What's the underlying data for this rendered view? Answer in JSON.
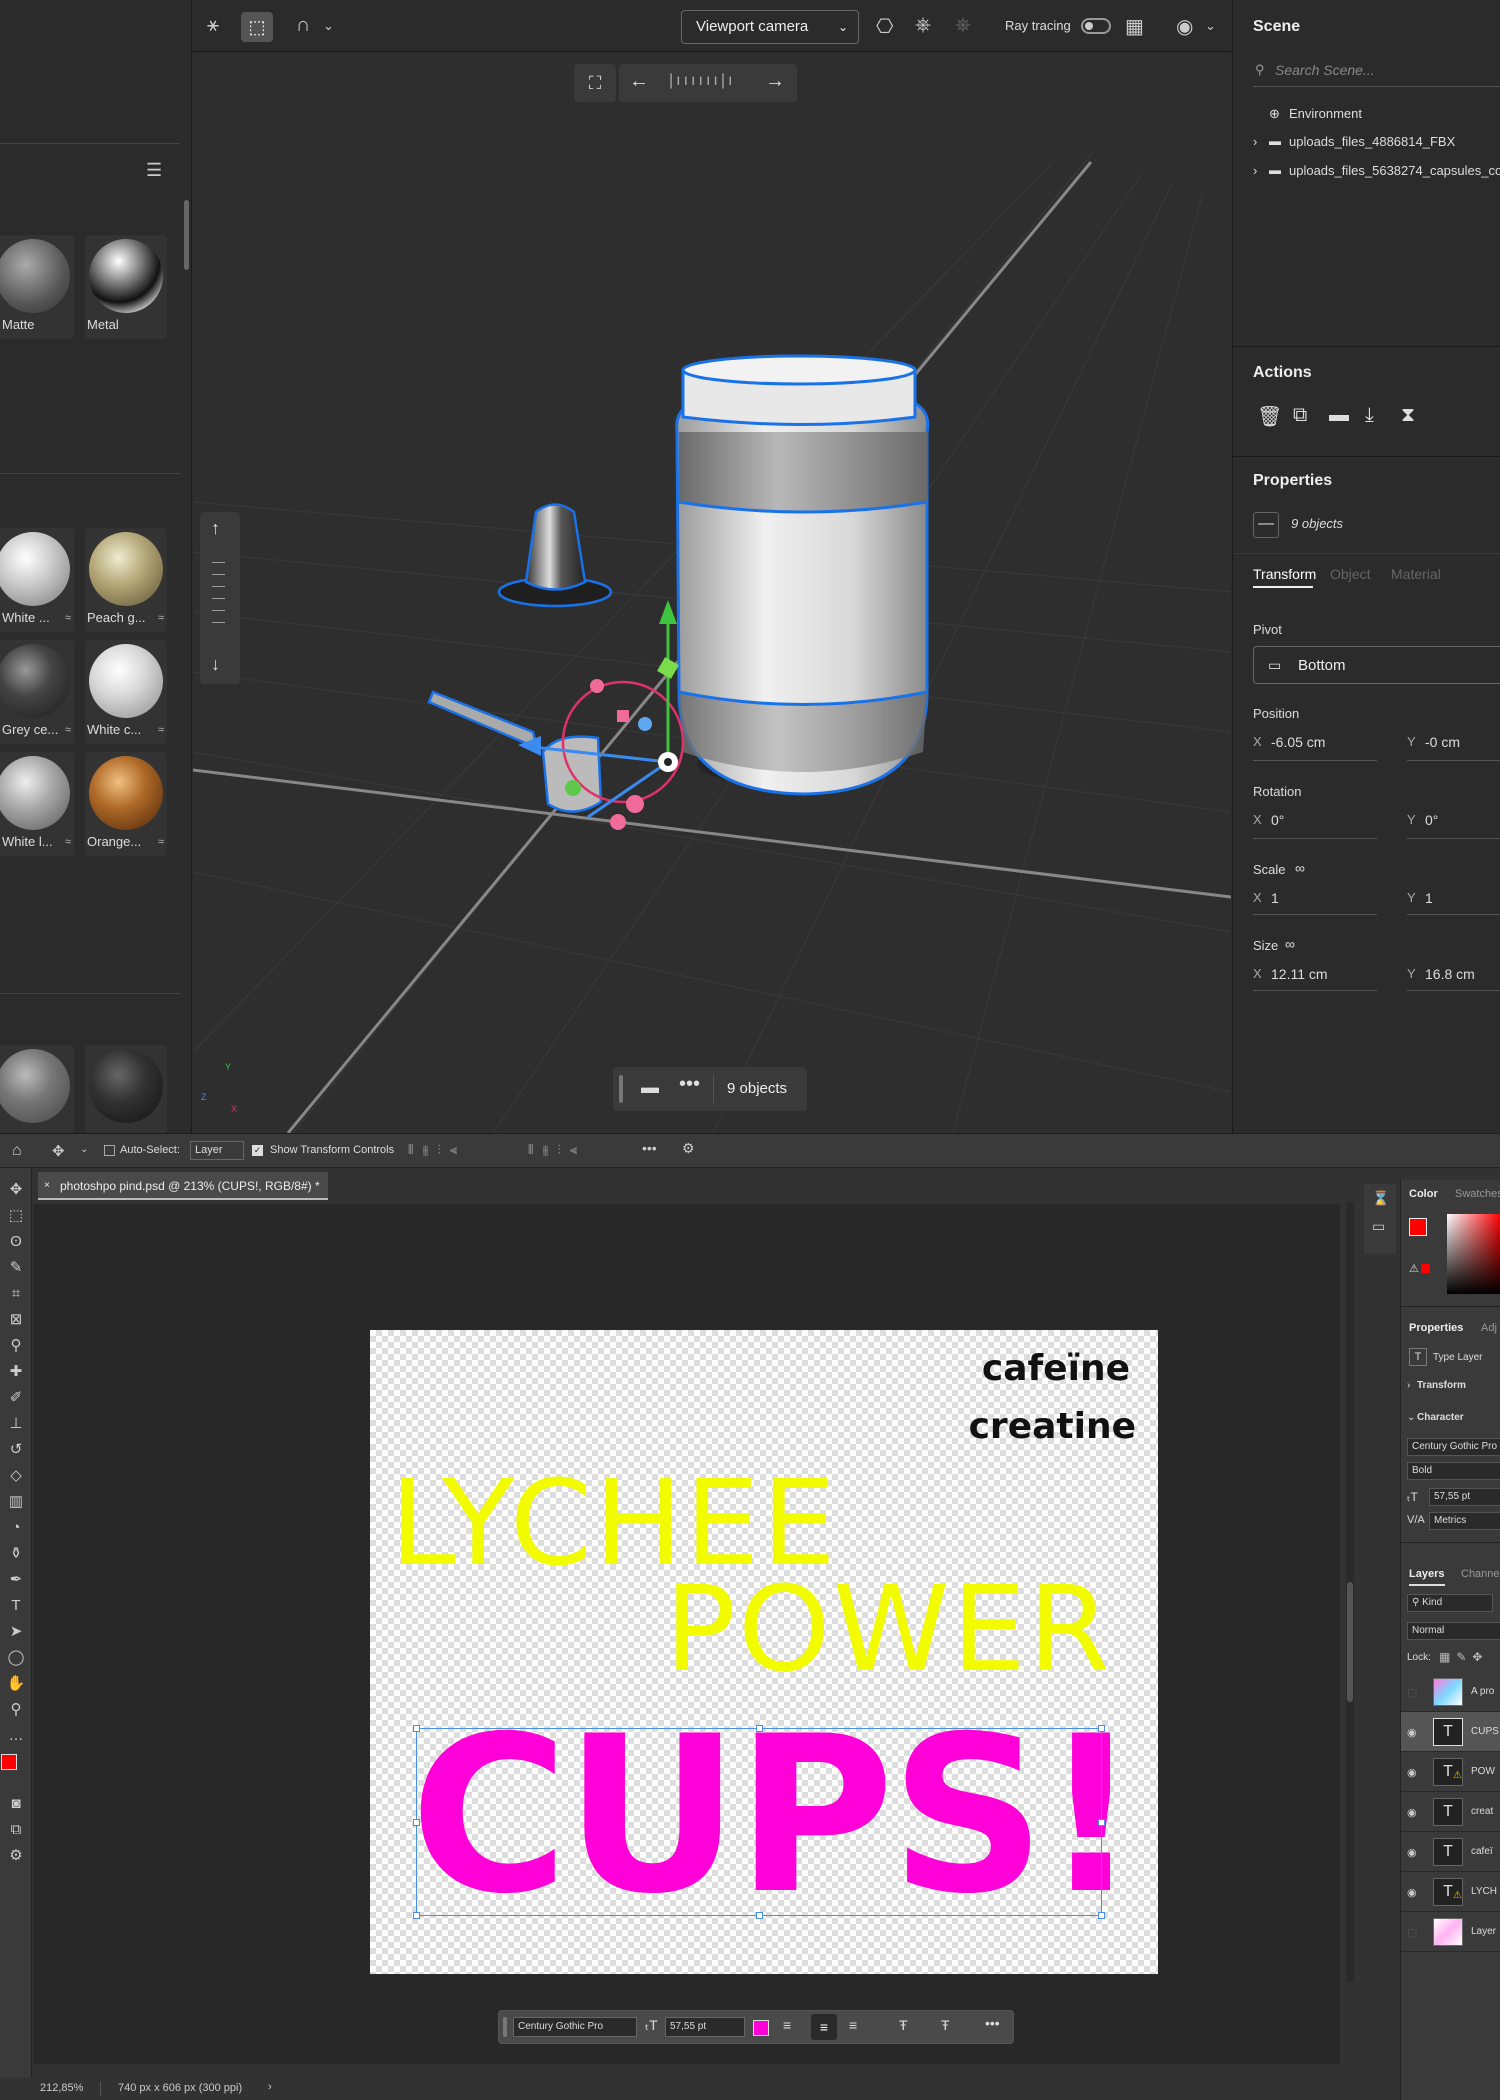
{
  "stager": {
    "toolbar": {
      "camera_select": "Viewport camera",
      "ray_tracing_label": "Ray tracing"
    },
    "materials": [
      {
        "label": "Matte",
        "color": "#8a8a8a"
      },
      {
        "label": "Metal",
        "color": "#d0d0d0"
      },
      {
        "label": "White ...",
        "color": "#e8e8e8"
      },
      {
        "label": "Peach g...",
        "color": "#b6a97a"
      },
      {
        "label": "Grey ce...",
        "color": "#5a5a5a"
      },
      {
        "label": "White c...",
        "color": "#e0e0e0"
      },
      {
        "label": "White l...",
        "color": "#bdbdbd"
      },
      {
        "label": "Orange...",
        "color": "#b06a28"
      }
    ],
    "scene": {
      "title": "Scene",
      "search_placeholder": "Search Scene...",
      "items": [
        "Environment",
        "uploads_files_4886814_FBX",
        "uploads_files_5638274_capsules_co"
      ]
    },
    "actions": {
      "title": "Actions"
    },
    "properties": {
      "title": "Properties",
      "selection": "9 objects",
      "tabs": [
        "Transform",
        "Object",
        "Material"
      ],
      "pivot_label": "Pivot",
      "pivot_value": "Bottom",
      "position_label": "Position",
      "position_x": "-6.05 cm",
      "position_y": "-0 cm",
      "rotation_label": "Rotation",
      "rotation_x": "0°",
      "rotation_y": "0°",
      "scale_label": "Scale",
      "scale_x": "1",
      "scale_y": "1",
      "size_label": "Size",
      "size_x": "12.11 cm",
      "size_y": "16.8 cm",
      "axis_x": "X",
      "axis_y": "Y"
    },
    "viewport_footer": {
      "objects": "9 objects"
    },
    "gizmo_axes": {
      "x": "X",
      "y": "Y",
      "z": "Z"
    }
  },
  "photoshop": {
    "options": {
      "auto_select": "Auto-Select:",
      "auto_select_value": "Layer",
      "show_transform": "Show Transform Controls"
    },
    "doc_tab": "photoshpo pind.psd @ 213% (CUPS!, RGB/8#) *",
    "artwork": {
      "line1": "cafeïne",
      "line2": "creatine",
      "line3": "LYCHEE",
      "line4": "POWER",
      "line5": "CUPS!",
      "yellow": "#f2fb00",
      "magenta": "#ff00d8"
    },
    "panels": {
      "color_tab": "Color",
      "swatches_tab": "Swatches",
      "properties_tab": "Properties",
      "adj_tab": "Adj",
      "type_layer": "Type Layer",
      "transform": "Transform",
      "character": "Character",
      "font_family": "Century Gothic Pro",
      "font_style": "Bold",
      "font_size": "57,55 pt",
      "kerning": "Metrics",
      "layers_tab": "Layers",
      "channels_tab": "Channe",
      "kind": "Kind",
      "blend": "Normal",
      "lock": "Lock:"
    },
    "layers": [
      {
        "name": "A pro",
        "icon": "img"
      },
      {
        "name": "CUPS",
        "icon": "T"
      },
      {
        "name": "POW",
        "icon": "T!"
      },
      {
        "name": "creat",
        "icon": "T"
      },
      {
        "name": "cafeï",
        "icon": "T"
      },
      {
        "name": "LYCH",
        "icon": "T!"
      },
      {
        "name": "Layer",
        "icon": "img"
      }
    ],
    "floatbar": {
      "font": "Century Gothic Pro",
      "size": "57,55 pt"
    },
    "status": {
      "zoom": "212,85%",
      "doc_size": "740 px x 606 px (300 ppi)"
    },
    "foreground_color": "#ff0000"
  }
}
